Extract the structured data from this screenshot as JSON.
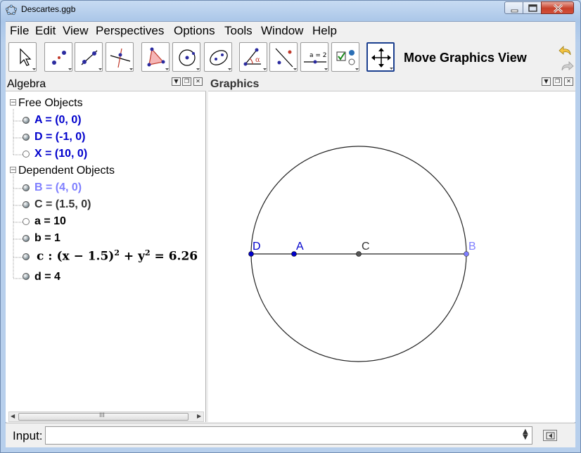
{
  "window": {
    "title": "Descartes.ggb"
  },
  "menu": [
    "File",
    "Edit",
    "View",
    "Perspectives",
    "Options",
    "Tools",
    "Window",
    "Help"
  ],
  "toolbar": {
    "active_tool_name": "Move Graphics View"
  },
  "algebra": {
    "title": "Algebra",
    "free_header": "Free Objects",
    "free": [
      {
        "text": "A = (0, 0)",
        "visible": true,
        "color": "#0000cc"
      },
      {
        "text": "D = (-1, 0)",
        "visible": true,
        "color": "#0000cc"
      },
      {
        "text": "X = (10, 0)",
        "visible": false,
        "color": "#0000cc"
      }
    ],
    "dependent_header": "Dependent Objects",
    "dependent": [
      {
        "text": "B = (4, 0)",
        "visible": true,
        "color": "#7f7fff"
      },
      {
        "text": "C = (1.5, 0)",
        "visible": true,
        "color": "#333333"
      },
      {
        "text": "a = 10",
        "visible": false,
        "color": "#000000"
      },
      {
        "text": "b = 1",
        "visible": true,
        "color": "#000000"
      },
      {
        "text": "d = 4",
        "visible": true,
        "color": "#000000"
      }
    ],
    "circle_eq": {
      "prefix": "c :",
      "body": "(x − 1.5)",
      "exp1": "2",
      "mid": " + y",
      "exp2": "2",
      "rhs": " = 6.26"
    }
  },
  "graphics": {
    "title": "Graphics",
    "points": [
      {
        "name": "D",
        "color": "#0000cc"
      },
      {
        "name": "A",
        "color": "#0000cc"
      },
      {
        "name": "C",
        "color": "#333333"
      },
      {
        "name": "B",
        "color": "#7f7fff"
      }
    ]
  },
  "scrollbar": {
    "grip": "III"
  },
  "input": {
    "label": "Input:",
    "value": ""
  }
}
